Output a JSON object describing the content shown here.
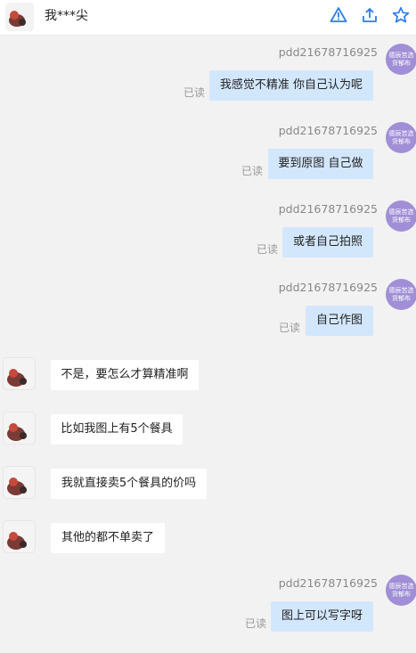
{
  "header": {
    "title": "我***尖",
    "actions": [
      "warning-icon",
      "share-icon",
      "star-icon"
    ]
  },
  "colors": {
    "outgoing_bubble": "#d3e7fc",
    "incoming_bubble": "#ffffff",
    "seller_avatar": "#a08fd6",
    "icon_blue": "#2b7de9"
  },
  "seller_avatar_text": "德辰苦选货郁布",
  "read_label": "已读",
  "messages": [
    {
      "dir": "out",
      "sender": "pdd21678716925",
      "text": "我感觉不精准 你自己认为呢",
      "status": "已读"
    },
    {
      "dir": "out",
      "sender": "pdd21678716925",
      "text": "要到原图 自己做",
      "status": "已读"
    },
    {
      "dir": "out",
      "sender": "pdd21678716925",
      "text": "或者自己拍照",
      "status": "已读"
    },
    {
      "dir": "out",
      "sender": "pdd21678716925",
      "text": "自己作图",
      "status": "已读"
    },
    {
      "dir": "in",
      "text": "不是，要怎么才算精准啊"
    },
    {
      "dir": "in",
      "text": "比如我图上有5个餐具"
    },
    {
      "dir": "in",
      "text": "我就直接卖5个餐具的价吗"
    },
    {
      "dir": "in",
      "text": "其他的都不单卖了"
    },
    {
      "dir": "out",
      "sender": "pdd21678716925",
      "text": "图上可以写字呀",
      "status": "已读"
    }
  ]
}
